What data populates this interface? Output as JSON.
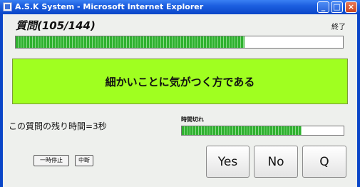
{
  "window": {
    "title": "A.S.K System - Microsoft Internet Explorer",
    "min_glyph": "_",
    "max_glyph": "□",
    "close_glyph": "×"
  },
  "question": {
    "title": "質問(105/144)",
    "current": 105,
    "total": 144,
    "text": "細かいことに気がつく方である"
  },
  "end_label": "終了",
  "progress": {
    "fraction": 0.7
  },
  "timer": {
    "remaining_text": "この質問の残り時間=3秒",
    "timeout_label": "時間切れ",
    "fraction": 0.74
  },
  "buttons": {
    "pause": "一時停止",
    "stop": "中断",
    "yes": "Yes",
    "no": "No",
    "q": "Q"
  },
  "colors": {
    "question_bg": "#a0ff20",
    "progress_fill": "#2fb12f",
    "titlebar": "#0a46c8"
  }
}
